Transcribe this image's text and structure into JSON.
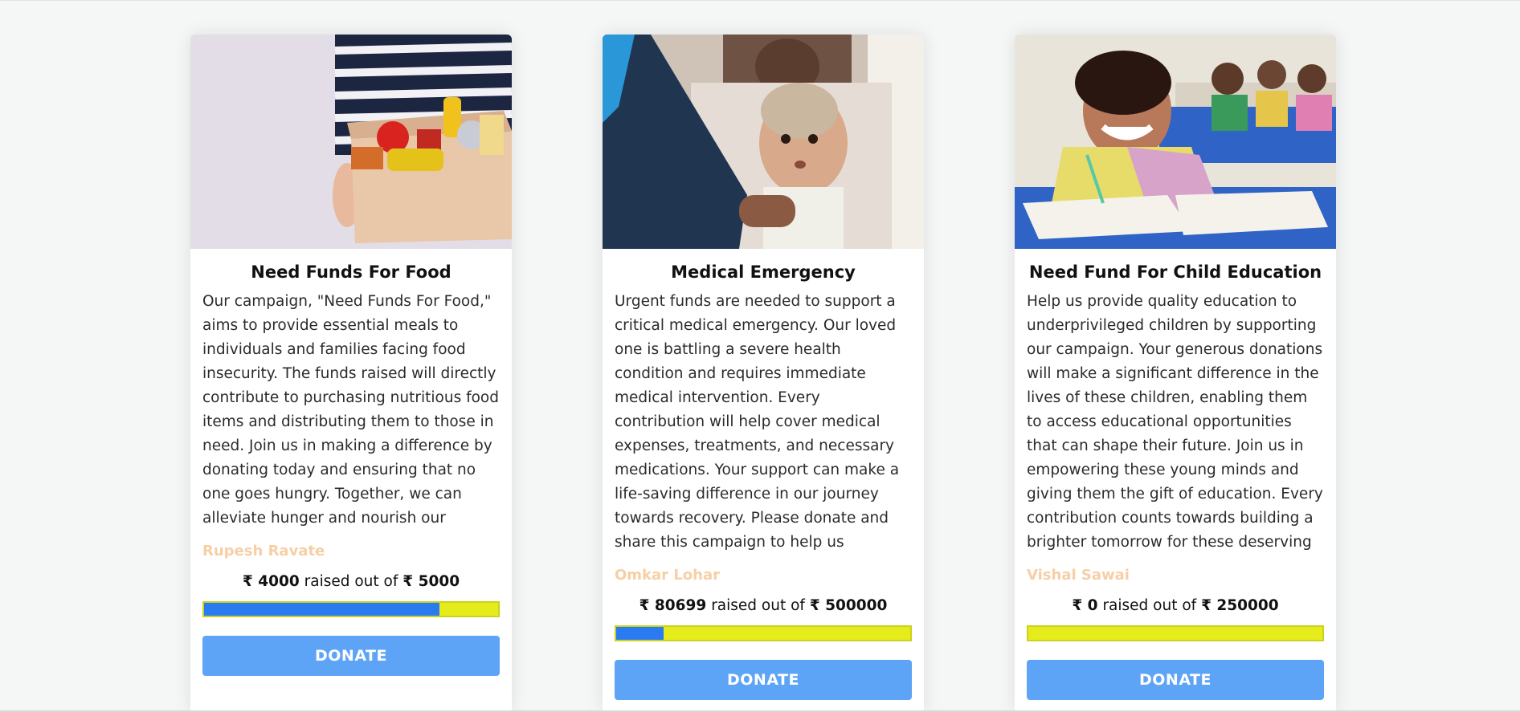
{
  "currency_symbol": "₹",
  "raised_text": "raised out of",
  "campaigns": [
    {
      "title": "Need Funds For Food",
      "description": "Our campaign, \"Need Funds For Food,\" aims to provide essential meals to individuals and families facing food insecurity. The funds raised will directly contribute to purchasing nutritious food items and distributing them to those in need. Join us in making a difference by donating today and ensuring that no one goes hungry. Together, we can alleviate hunger and nourish our communities.",
      "author": "Rupesh Ravate",
      "raised": "4000",
      "goal": "5000",
      "progress": 0.8,
      "donate_label": "DONATE",
      "image_icon": "food-box-photo"
    },
    {
      "title": "Medical Emergency",
      "description": "Urgent funds are needed to support a critical medical emergency. Our loved one is battling a severe health condition and requires immediate medical intervention. Every contribution will help cover medical expenses, treatments, and necessary medications. Your support can make a life-saving difference in our journey towards recovery. Please donate and share this campaign to help us overcome this medical crisis.",
      "author": "Omkar Lohar",
      "raised": "80699",
      "goal": "500000",
      "progress": 0.161,
      "donate_label": "DONATE",
      "image_icon": "child-medical-photo"
    },
    {
      "title": "Need Fund For Child Education",
      "description": "Help us provide quality education to underprivileged children by supporting our campaign. Your generous donations will make a significant difference in the lives of these children, enabling them to access educational opportunities that can shape their future. Join us in empowering these young minds and giving them the gift of education. Every contribution counts towards building a brighter tomorrow for these deserving children.",
      "author": "Vishal Sawai",
      "raised": "0",
      "goal": "250000",
      "progress": 0.0,
      "donate_label": "DONATE",
      "image_icon": "classroom-student-photo"
    }
  ],
  "colors": {
    "progress_fill": "#2a7bf2",
    "progress_track": "#e6ec1b",
    "donate_button": "#5ea4f6",
    "author_name": "#f6cfa5"
  }
}
